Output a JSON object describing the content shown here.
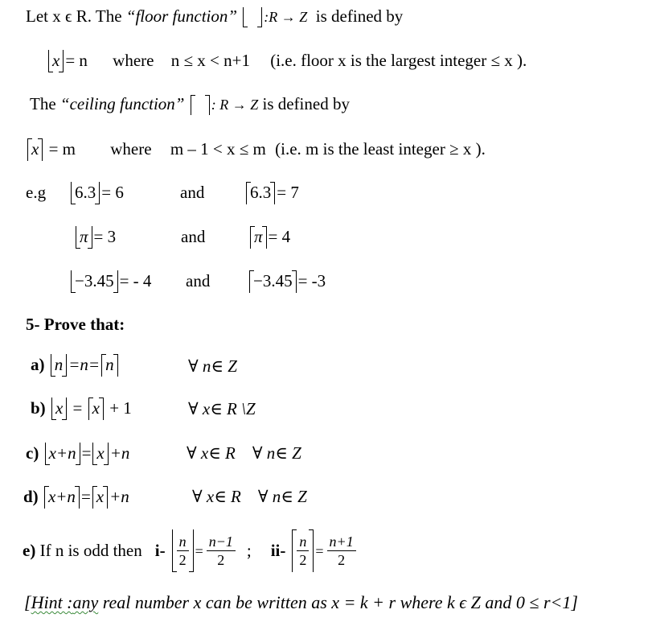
{
  "definitions": {
    "floor_intro": {
      "prefix": "Let x ϵ R. The ",
      "term": "“floor function”",
      "mapping": ":R → Z",
      "suffix": "is defined by"
    },
    "floor_def": {
      "arg": "x",
      "eq": "= n",
      "where": "where",
      "condition": "n ≤ x < n+1",
      "note": "(i.e. floor x is the largest integer ≤ x )."
    },
    "ceil_intro": {
      "prefix": "The ",
      "term": "“ceiling function”",
      "mapping": ": R → Z",
      "suffix": "is defined by"
    },
    "ceil_def": {
      "arg": "x",
      "eq": "= m",
      "where": "where",
      "condition": "m – 1 < x ≤ m",
      "note": "(i.e. m is the least integer ≥ x )."
    }
  },
  "examples": {
    "label": "e.g",
    "and": "and",
    "rows": [
      {
        "floor_arg": "6.3",
        "floor_val": "= 6",
        "ceil_arg": "6.3",
        "ceil_val": "= 7"
      },
      {
        "floor_arg": "π",
        "floor_val": "= 3",
        "ceil_arg": "π",
        "ceil_val": "= 4"
      },
      {
        "floor_arg": "−3.45",
        "floor_val": "= - 4",
        "ceil_arg": "−3.45",
        "ceil_val": "= -3"
      }
    ]
  },
  "problem": {
    "title": "5- Prove that:",
    "items": [
      {
        "label": "a)",
        "quant": "∀ n∈ Z",
        "parts": {
          "n": "n",
          "mid": "=n=",
          "eq": "="
        }
      },
      {
        "label": "b)",
        "quant": "∀ x∈ R \\Z",
        "parts": {
          "x": "x",
          "eq": "=",
          "plus": "+ 1"
        }
      },
      {
        "label": "c)",
        "quant": "∀ x∈ R    ∀ n∈ Z",
        "parts": {
          "lhs": "x+n",
          "eq": "=",
          "x": "x",
          "plus": "+n"
        }
      },
      {
        "label": "d)",
        "quant": "∀ x∈ R    ∀ n∈ Z",
        "parts": {
          "lhs": "x+n",
          "eq": "=",
          "x": "x",
          "plus": "+n"
        }
      },
      {
        "label": "e)",
        "text": "If n is odd then",
        "i": "i-",
        "ii": "ii-",
        "sep": ";",
        "frac_num": "n",
        "frac_den": "2",
        "eq": "=",
        "rhs_i_num": "n−1",
        "rhs_ii_num": "n+1",
        "rhs_den": "2"
      }
    ]
  },
  "hint": {
    "open": "[",
    "word1": "Hint :",
    "word2": "any",
    "rest": " real number x can be written as x = k + r where k ϵ Z and 0 ≤ r<1]"
  }
}
